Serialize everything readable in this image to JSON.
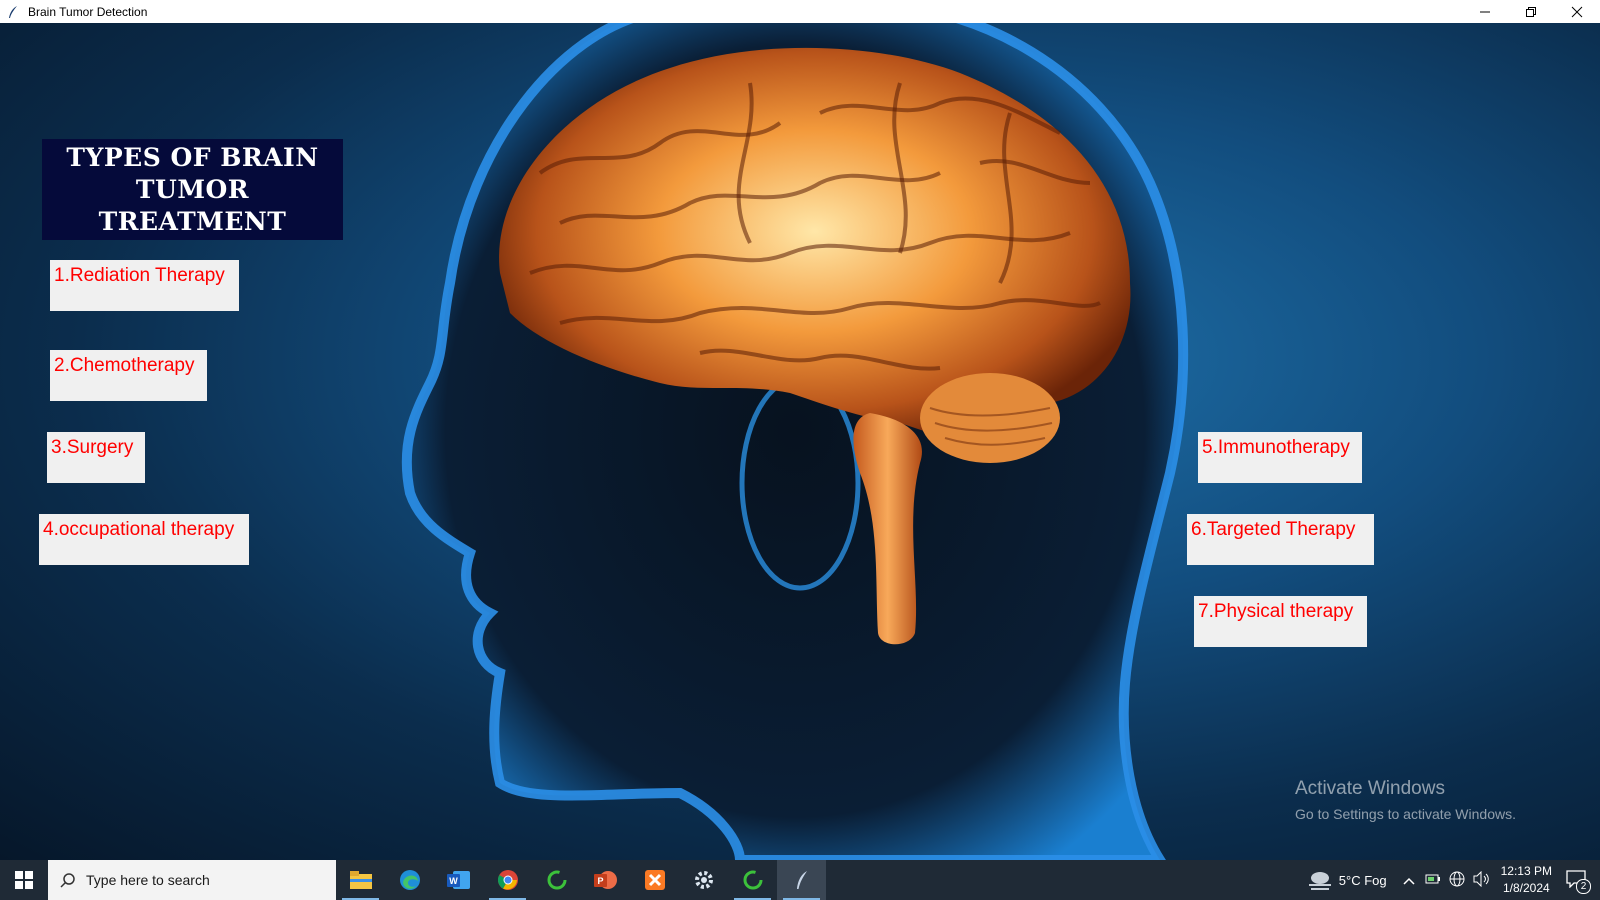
{
  "window": {
    "title": "Brain Tumor Detection",
    "icons": {
      "app": "feather-icon",
      "minimize": "minimize-icon",
      "restore": "restore-icon",
      "close": "close-icon"
    }
  },
  "main": {
    "heading_line1": "TYPES OF BRAIN",
    "heading_line2": "TUMOR TREATMENT",
    "left_treatments": [
      "1.Rediation Therapy",
      "2.Chemotherapy",
      "3.Surgery",
      "4.occupational therapy"
    ],
    "right_treatments": [
      "5.Immunotherapy",
      "6.Targeted Therapy",
      "7.Physical therapy"
    ],
    "colors": {
      "heading_bg": "#050a3a",
      "button_bg": "#f0f0f0",
      "button_text": "#ff0000"
    }
  },
  "watermark": {
    "line1": "Activate Windows",
    "line2": "Go to Settings to activate Windows."
  },
  "taskbar": {
    "search_placeholder": "Type here to search",
    "apps": [
      "file-explorer-icon",
      "edge-icon",
      "word-icon",
      "chrome-icon",
      "refresh-app-icon",
      "powerpoint-icon",
      "xampp-icon",
      "settings-icon",
      "refresh-app-icon",
      "feather-icon"
    ],
    "weather": "5°C  Fog",
    "time": "12:13 PM",
    "date": "1/8/2024",
    "notification_count": "2"
  }
}
